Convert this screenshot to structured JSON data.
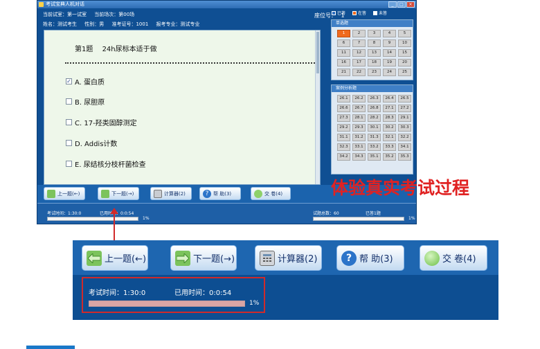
{
  "window": {
    "title": "考试宝典人机对话",
    "controls": [
      "_",
      "□",
      "×"
    ]
  },
  "info": {
    "room": "当前试室：第一试室",
    "session": "当前场次：第00场",
    "name": "姓名：测试考生",
    "gender": "性别：男",
    "ticket": "准考证号：1001",
    "major": "报考专业：测试专业",
    "seat_label": "座位号：",
    "seat_value": "1"
  },
  "question": {
    "number": "第1题",
    "text": "24h尿标本适于做",
    "options": [
      {
        "label": "A. 蛋白质",
        "checked": true,
        "mark": "✓"
      },
      {
        "label": "B. 尿胆原",
        "checked": false,
        "mark": ""
      },
      {
        "label": "C. 17-羟类固醇测定",
        "checked": false,
        "mark": ""
      },
      {
        "label": "D. Addis计数",
        "checked": false,
        "mark": ""
      },
      {
        "label": "E. 尿结核分枝杆菌检查",
        "checked": false,
        "mark": ""
      }
    ]
  },
  "legend": {
    "answered": "已答",
    "answering": "在答",
    "unanswered": "未答",
    "colors": {
      "answered": "#2f6fc0",
      "answering": "#f06a1e",
      "unanswered": "#ffffff"
    }
  },
  "groups": {
    "single": {
      "title": "单选题",
      "cells": [
        "1",
        "2",
        "3",
        "4",
        "5",
        "6",
        "7",
        "8",
        "9",
        "10",
        "11",
        "12",
        "13",
        "14",
        "15",
        "16",
        "17",
        "18",
        "19",
        "20",
        "21",
        "22",
        "23",
        "24",
        "25"
      ]
    },
    "case": {
      "title": "案例分析题",
      "cells": [
        "26.1",
        "26.2",
        "26.3",
        "26.4",
        "26.5",
        "26.6",
        "26.7",
        "26.8",
        "27.1",
        "27.2",
        "27.3",
        "28.1",
        "28.2",
        "28.3",
        "29.1",
        "29.2",
        "29.3",
        "30.1",
        "30.2",
        "30.3",
        "31.1",
        "31.2",
        "31.3",
        "32.1",
        "32.2",
        "32.3",
        "33.1",
        "33.2",
        "33.3",
        "34.1",
        "34.2",
        "34.3",
        "35.1",
        "35.2",
        "35.3"
      ]
    }
  },
  "toolbar": {
    "prev": "上一题(←)",
    "next": "下一题(→)",
    "calc": "计算器(2)",
    "help": "帮 助(3)",
    "submit": "交 卷(4)"
  },
  "zoom_toolbar": {
    "prev": "上一题(←)",
    "next": "下一题(→)",
    "calc": "计算器(2)",
    "help": "帮 助(3)",
    "submit": "交 卷(4)"
  },
  "status": {
    "exam_time": "考试时间：1:30:0",
    "used_time": "已用时间：0:0:54",
    "percent": "1%",
    "progress": 0.01,
    "total_label": "试题总数：60",
    "answered_label": "已答1题"
  },
  "zoom_status": {
    "exam_time": "考试时间：1:30:0",
    "used_time": "已用时间：0:0:54",
    "percent": "1%"
  },
  "callout": "体验真实考试过程"
}
